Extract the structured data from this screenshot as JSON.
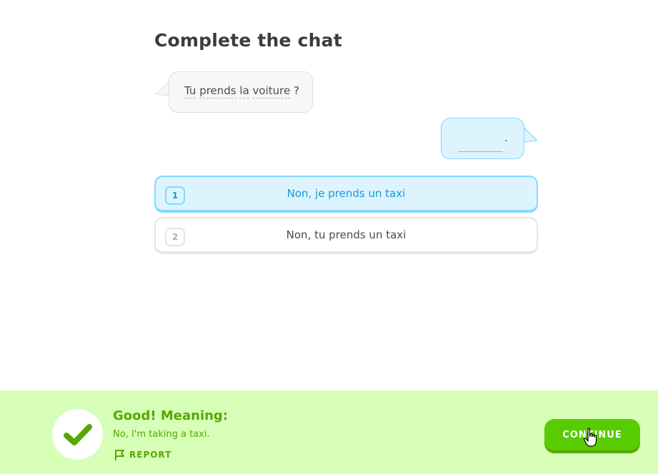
{
  "header": {
    "title": "Complete the chat"
  },
  "chat": {
    "prompt_words": [
      "Tu",
      "prends",
      "la",
      "voiture",
      "?"
    ],
    "response_end": "."
  },
  "options": [
    {
      "number": "1",
      "label": "Non, je prends un taxi",
      "selected": true
    },
    {
      "number": "2",
      "label": "Non, tu prends un taxi",
      "selected": false
    }
  ],
  "feedback": {
    "title": "Good! Meaning:",
    "meaning": "No, I'm taking a taxi.",
    "report_label": "REPORT",
    "continue_label": "CONTINUE",
    "icon": "check-icon"
  },
  "colors": {
    "feedback_bg": "#d7ffb8",
    "feedback_text": "#58a700",
    "continue_bg": "#58cc02",
    "selected_bg": "#ddf4ff",
    "selected_text": "#1899d6"
  }
}
